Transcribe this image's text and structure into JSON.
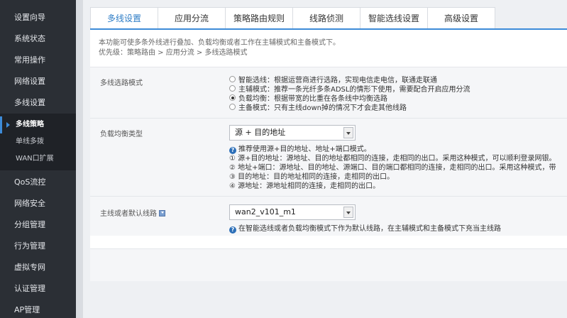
{
  "sidebar": {
    "items_top": [
      {
        "label": "设置向导"
      },
      {
        "label": "系统状态"
      },
      {
        "label": "常用操作"
      },
      {
        "label": "网络设置"
      },
      {
        "label": "多线设置"
      }
    ],
    "sub_items": [
      {
        "label": "多线策略",
        "active": true
      },
      {
        "label": "单线多拨"
      },
      {
        "label": "WAN口扩展"
      }
    ],
    "items_bottom": [
      {
        "label": "QoS流控"
      },
      {
        "label": "网络安全"
      },
      {
        "label": "分组管理"
      },
      {
        "label": "行为管理"
      },
      {
        "label": "虚拟专网"
      },
      {
        "label": "认证管理"
      },
      {
        "label": "AP管理"
      }
    ]
  },
  "tabs": [
    {
      "label": "多线设置",
      "active": true
    },
    {
      "label": "应用分流"
    },
    {
      "label": "策略路由规则"
    },
    {
      "label": "线路侦测"
    },
    {
      "label": "智能选线设置"
    },
    {
      "label": "高级设置"
    }
  ],
  "intro": {
    "line1": "本功能可使多条外线进行叠加、负载均衡或者工作在主辅模式和主备模式下。",
    "line2": "优先级：策略路由 > 应用分流 > 多线选路模式"
  },
  "mode": {
    "label": "多线选路模式",
    "options": [
      {
        "text": "智能选线：根据运营商进行选路，实现电信走电信，联通走联通",
        "checked": false
      },
      {
        "text": "主辅模式：推荐一条光纤多条ADSL的情形下使用，需要配合开启应用分流",
        "checked": false
      },
      {
        "text": "负载均衡：根据带宽的比重在各条线中均衡选路",
        "checked": true
      },
      {
        "text": "主备模式：只有主线down掉的情况下才会走其他线路",
        "checked": false
      }
    ]
  },
  "balance": {
    "label": "负载均衡类型",
    "selected": "源 + 目的地址",
    "help_title": "推荐使用源+目的地址、地址+端口模式。",
    "help_lines": [
      "① 源+目的地址：源地址、目的地址都相同的连接，走相同的出口。采用这种模式，可以顺利登录网银。",
      "② 地址+端口：源地址、目的地址、源端口、目的端口都相同的连接，走相同的出口。采用这种模式，带",
      "③ 目的地址：目的地址相同的连接，走相同的出口。",
      "④ 源地址：源地址相同的连接，走相同的出口。"
    ]
  },
  "default_line": {
    "label": "主线或者默认线路",
    "selected": "wan2_v101_m1",
    "help": "在智能选线或者负载均衡模式下作为默认线路，在主辅模式和主备模式下充当主线路"
  },
  "colors": {
    "sidebar_bg": "#2b2f35",
    "accent": "#3d8bd8",
    "active_tab_text": "#2c7cc6"
  }
}
